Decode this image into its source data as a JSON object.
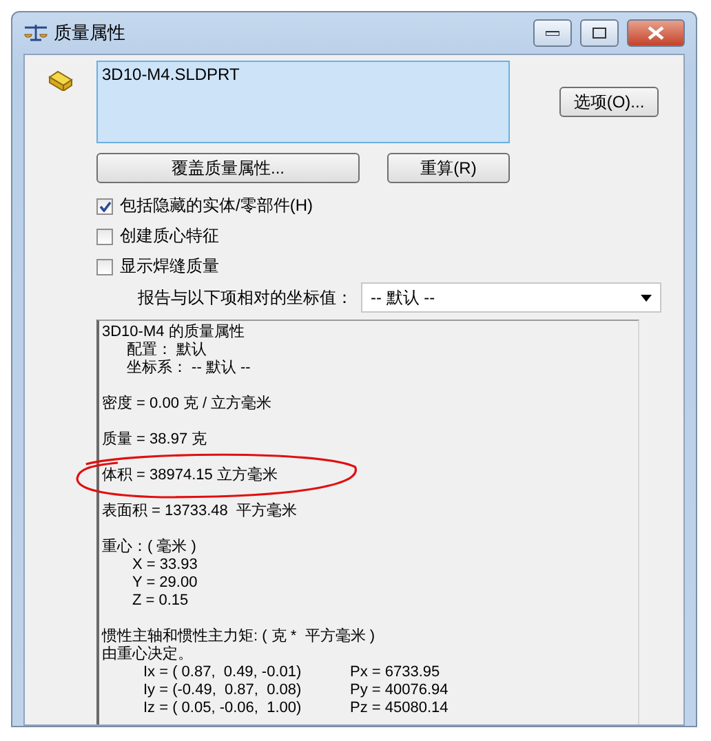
{
  "window": {
    "title": "质量属性"
  },
  "part_list": {
    "items": [
      "3D10-M4.SLDPRT"
    ]
  },
  "buttons": {
    "options": "选项(O)...",
    "override": "覆盖质量属性...",
    "recalculate": "重算(R)"
  },
  "checkboxes": [
    {
      "label": "包括隐藏的实体/零部件(H)",
      "checked": true
    },
    {
      "label": "创建质心特征",
      "checked": false
    },
    {
      "label": "显示焊缝质量",
      "checked": false
    }
  ],
  "coordinate_select": {
    "label": "报告与以下项相对的坐标值：",
    "value": "-- 默认 --"
  },
  "report": {
    "blocks": [
      {
        "highlighted": false,
        "lines": [
          {
            "kind": "plain",
            "text": "3D10-M4 的质量属性"
          },
          {
            "kind": "indented",
            "text": "配置： 默认"
          },
          {
            "kind": "indented",
            "text": "坐标系： -- 默认 --"
          }
        ]
      },
      {
        "highlighted": false,
        "lines": [
          {
            "kind": "plain",
            "text": "密度 = 0.00 克 / 立方毫米"
          }
        ]
      },
      {
        "highlighted": false,
        "lines": [
          {
            "kind": "plain",
            "text": "质量 = 38.97 克"
          }
        ]
      },
      {
        "highlighted": true,
        "lines": [
          {
            "kind": "plain",
            "text": "体积 = 38974.15 立方毫米"
          }
        ]
      },
      {
        "highlighted": false,
        "lines": [
          {
            "kind": "plain",
            "text": "表面积 = 13733.48  平方毫米"
          }
        ]
      },
      {
        "highlighted": false,
        "lines": [
          {
            "kind": "plain",
            "text": "重心：( 毫米 )"
          },
          {
            "kind": "deep",
            "text": "X = 33.93"
          },
          {
            "kind": "deep",
            "text": "Y = 29.00"
          },
          {
            "kind": "deep",
            "text": "Z = 0.15"
          }
        ]
      },
      {
        "highlighted": false,
        "lines": [
          {
            "kind": "plain",
            "text": "惯性主轴和惯性主力矩: ( 克 *  平方毫米 )"
          },
          {
            "kind": "plain",
            "text": "由重心决定。"
          },
          {
            "kind": "axis",
            "text": "Ix = ( 0.87,  0.49, -0.01)",
            "moment": "Px = 6733.95"
          },
          {
            "kind": "axis",
            "text": "Iy = (-0.49,  0.87,  0.08)",
            "moment": "Py = 40076.94"
          },
          {
            "kind": "axis",
            "text": "Iz = ( 0.05, -0.06,  1.00)",
            "moment": "Pz = 45080.14"
          }
        ]
      }
    ]
  }
}
